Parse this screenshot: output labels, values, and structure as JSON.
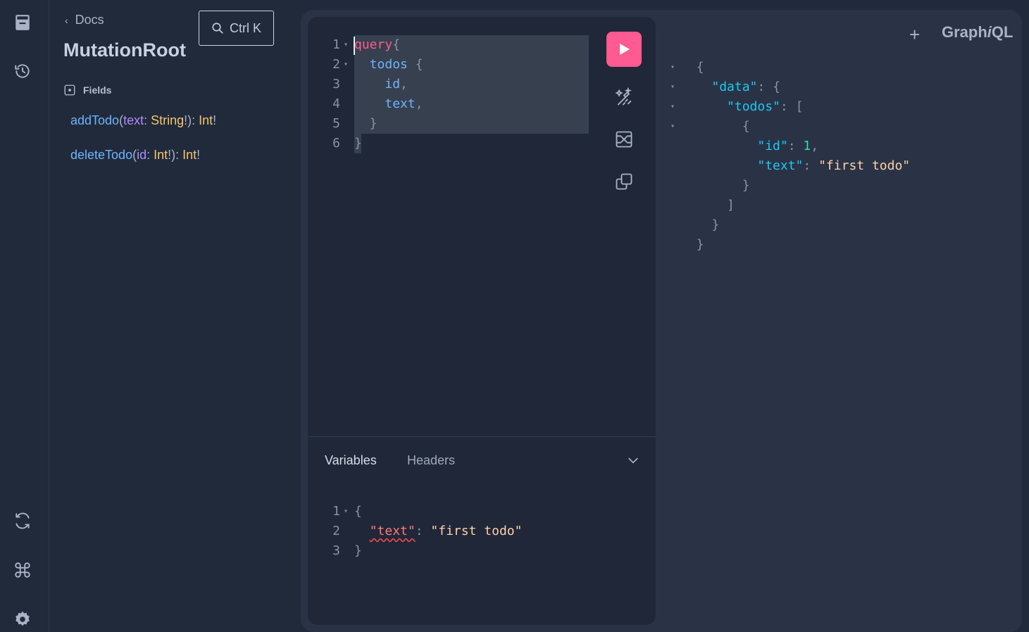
{
  "docs": {
    "back_label": "Docs",
    "title": "MutationRoot",
    "search_shortcut": "Ctrl K",
    "fields_heading": "Fields",
    "fields": [
      {
        "name": "addTodo",
        "open": "(",
        "arg": "text",
        "colon": ": ",
        "arg_type": "String",
        "bang": "!",
        "close": "): ",
        "ret": "Int",
        "ret_bang": "!"
      },
      {
        "name": "deleteTodo",
        "open": "(",
        "arg": "id",
        "colon": ": ",
        "arg_type": "Int",
        "bang": "!",
        "close": "): ",
        "ret": "Int",
        "ret_bang": "!"
      }
    ]
  },
  "query_lines": [
    {
      "n": "1",
      "fold": "▾",
      "parts": [
        [
          "kw",
          "query"
        ],
        [
          "pn",
          "{"
        ]
      ]
    },
    {
      "n": "2",
      "fold": "▾",
      "parts": [
        [
          "pn",
          "  "
        ],
        [
          "fld",
          "todos"
        ],
        [
          "pn",
          " {"
        ]
      ]
    },
    {
      "n": "3",
      "fold": "",
      "parts": [
        [
          "pn",
          "    "
        ],
        [
          "fld",
          "id"
        ],
        [
          "pn",
          ","
        ]
      ]
    },
    {
      "n": "4",
      "fold": "",
      "parts": [
        [
          "pn",
          "    "
        ],
        [
          "fld",
          "text"
        ],
        [
          "pn",
          ","
        ]
      ]
    },
    {
      "n": "5",
      "fold": "",
      "parts": [
        [
          "pn",
          "  }"
        ]
      ]
    },
    {
      "n": "6",
      "fold": "",
      "parts": [
        [
          "pn",
          "}"
        ]
      ]
    }
  ],
  "tabs": {
    "variables": "Variables",
    "headers": "Headers"
  },
  "variables_lines": [
    {
      "n": "1",
      "fold": "▾",
      "parts": [
        [
          "pn",
          "{"
        ]
      ]
    },
    {
      "n": "2",
      "fold": "",
      "parts": [
        [
          "pn",
          "  "
        ],
        [
          "vkey squig",
          "\"text\""
        ],
        [
          "pn",
          ": "
        ],
        [
          "str",
          "\"first todo\""
        ]
      ]
    },
    {
      "n": "3",
      "fold": "",
      "parts": [
        [
          "pn",
          "}"
        ]
      ]
    }
  ],
  "response_lines": [
    {
      "fold": "▾",
      "parts": [
        [
          "pn",
          "  {"
        ]
      ]
    },
    {
      "fold": "▾",
      "parts": [
        [
          "pn",
          "    "
        ],
        [
          "key",
          "\"data\""
        ],
        [
          "pn",
          ": {"
        ]
      ]
    },
    {
      "fold": "▾",
      "parts": [
        [
          "pn",
          "      "
        ],
        [
          "key",
          "\"todos\""
        ],
        [
          "pn",
          ": ["
        ]
      ]
    },
    {
      "fold": "▾",
      "parts": [
        [
          "pn",
          "        {"
        ]
      ]
    },
    {
      "fold": "",
      "parts": [
        [
          "pn",
          "          "
        ],
        [
          "key",
          "\"id\""
        ],
        [
          "pn",
          ": "
        ],
        [
          "num",
          "1"
        ],
        [
          "pn",
          ","
        ]
      ]
    },
    {
      "fold": "",
      "parts": [
        [
          "pn",
          "          "
        ],
        [
          "key",
          "\"text\""
        ],
        [
          "pn",
          ": "
        ],
        [
          "str",
          "\"first todo\""
        ]
      ]
    },
    {
      "fold": "",
      "parts": [
        [
          "pn",
          "        }"
        ]
      ]
    },
    {
      "fold": "",
      "parts": [
        [
          "pn",
          "      ]"
        ]
      ]
    },
    {
      "fold": "",
      "parts": [
        [
          "pn",
          "    }"
        ]
      ]
    },
    {
      "fold": "",
      "parts": [
        [
          "pn",
          "  }"
        ]
      ]
    }
  ],
  "header": {
    "plus": "+",
    "logo_pre": "Graph",
    "logo_i": "i",
    "logo_post": "QL"
  },
  "icons": {
    "rail": [
      "docs-icon",
      "history-icon",
      "refetch-schema-icon",
      "shortcuts-icon",
      "settings-icon"
    ],
    "toolbar": [
      "run-icon",
      "prettify-icon",
      "merge-fragments-icon",
      "copy-icon"
    ]
  },
  "colors": {
    "accent": "#ff5a91",
    "keyword": "#ff5b8a",
    "field": "#6fb3ff",
    "type": "#f7c56c",
    "json_key": "#1fc8f2",
    "number": "#2ee0a0",
    "string": "#ffd1a8"
  }
}
